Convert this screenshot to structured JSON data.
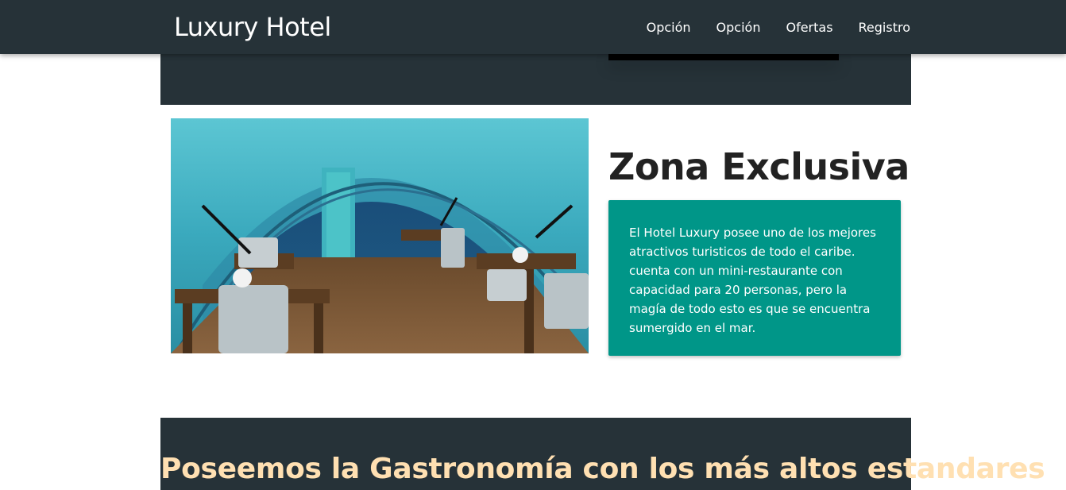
{
  "navbar": {
    "brand": "Luxury Hotel",
    "links": [
      "Opción",
      "Opción",
      "Ofertas",
      "Registro"
    ]
  },
  "exclusive": {
    "title": "Zona Exclusiva",
    "description": "El Hotel Luxury posee uno de los mejores atractivos turisticos de todo el caribe. cuenta con un mini-restaurante con capacidad para 20 personas, pero la magía de todo esto es que se encuentra sumergido en el mar."
  },
  "gastronomy": {
    "title": "Poseemos la Gastronomía con los más altos estandares"
  },
  "colors": {
    "dark": "#263238",
    "teal": "#009688",
    "heading_warm": "#ffe0b2"
  },
  "icons": [
    "underwater-restaurant-photo"
  ]
}
